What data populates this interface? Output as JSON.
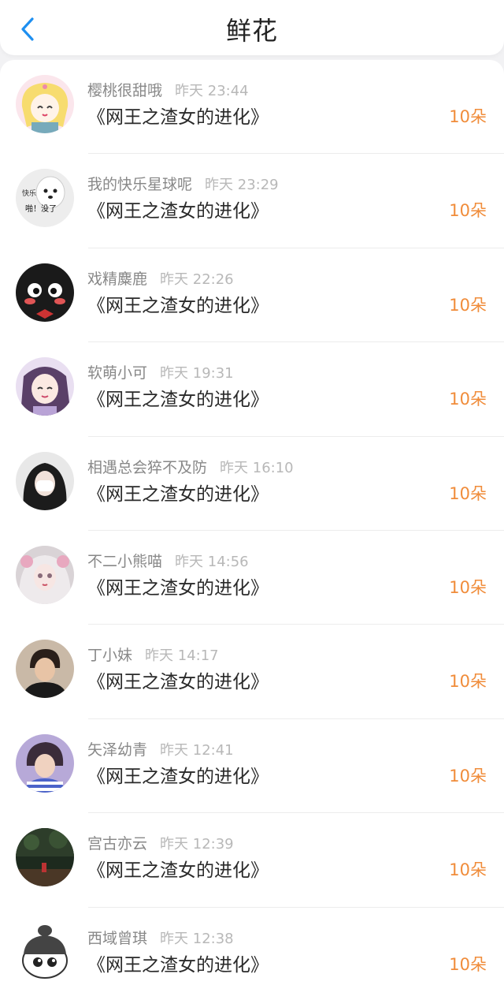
{
  "header": {
    "title": "鲜花",
    "back_icon": "chevron-left-icon",
    "accent_color": "#1e8ff0"
  },
  "colors": {
    "amount": "#f08c3a",
    "name": "#888888",
    "time": "#b8b8b8"
  },
  "items": [
    {
      "name": "樱桃很甜哦",
      "time": "昨天 23:44",
      "book": "《网王之渣女的进化》",
      "amount": "10朵"
    },
    {
      "name": "我的快乐星球呢",
      "time": "昨天 23:29",
      "book": "《网王之渣女的进化》",
      "amount": "10朵",
      "avatar_text": "快乐\n啪！没了"
    },
    {
      "name": "戏精麋鹿",
      "time": "昨天 22:26",
      "book": "《网王之渣女的进化》",
      "amount": "10朵"
    },
    {
      "name": "软萌小可",
      "time": "昨天 19:31",
      "book": "《网王之渣女的进化》",
      "amount": "10朵"
    },
    {
      "name": "相遇总会猝不及防",
      "time": "昨天 16:10",
      "book": "《网王之渣女的进化》",
      "amount": "10朵"
    },
    {
      "name": "不二小熊喵",
      "time": "昨天 14:56",
      "book": "《网王之渣女的进化》",
      "amount": "10朵"
    },
    {
      "name": "丁小妹",
      "time": "昨天 14:17",
      "book": "《网王之渣女的进化》",
      "amount": "10朵"
    },
    {
      "name": "矢泽幼青",
      "time": "昨天 12:41",
      "book": "《网王之渣女的进化》",
      "amount": "10朵"
    },
    {
      "name": "宫古亦云",
      "time": "昨天 12:39",
      "book": "《网王之渣女的进化》",
      "amount": "10朵"
    },
    {
      "name": "西域曾琪",
      "time": "昨天 12:38",
      "book": "《网王之渣女的进化》",
      "amount": "10朵"
    }
  ]
}
